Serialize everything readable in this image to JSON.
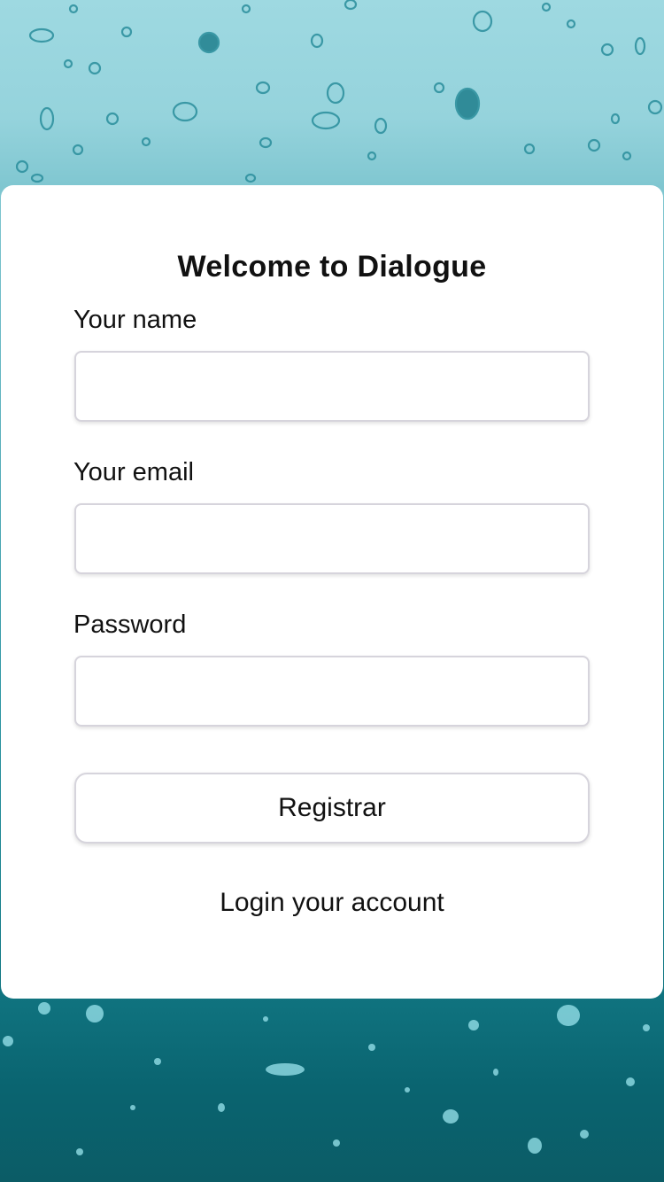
{
  "background": {
    "description_colors": {
      "top": "#9ed9e1",
      "bottom": "#0b5c66"
    }
  },
  "form": {
    "title": "Welcome to Dialogue",
    "name_label": "Your name",
    "name_value": "",
    "email_label": "Your email",
    "email_value": "",
    "password_label": "Password",
    "password_value": "",
    "submit_label": "Registrar",
    "login_link": "Login your account"
  }
}
